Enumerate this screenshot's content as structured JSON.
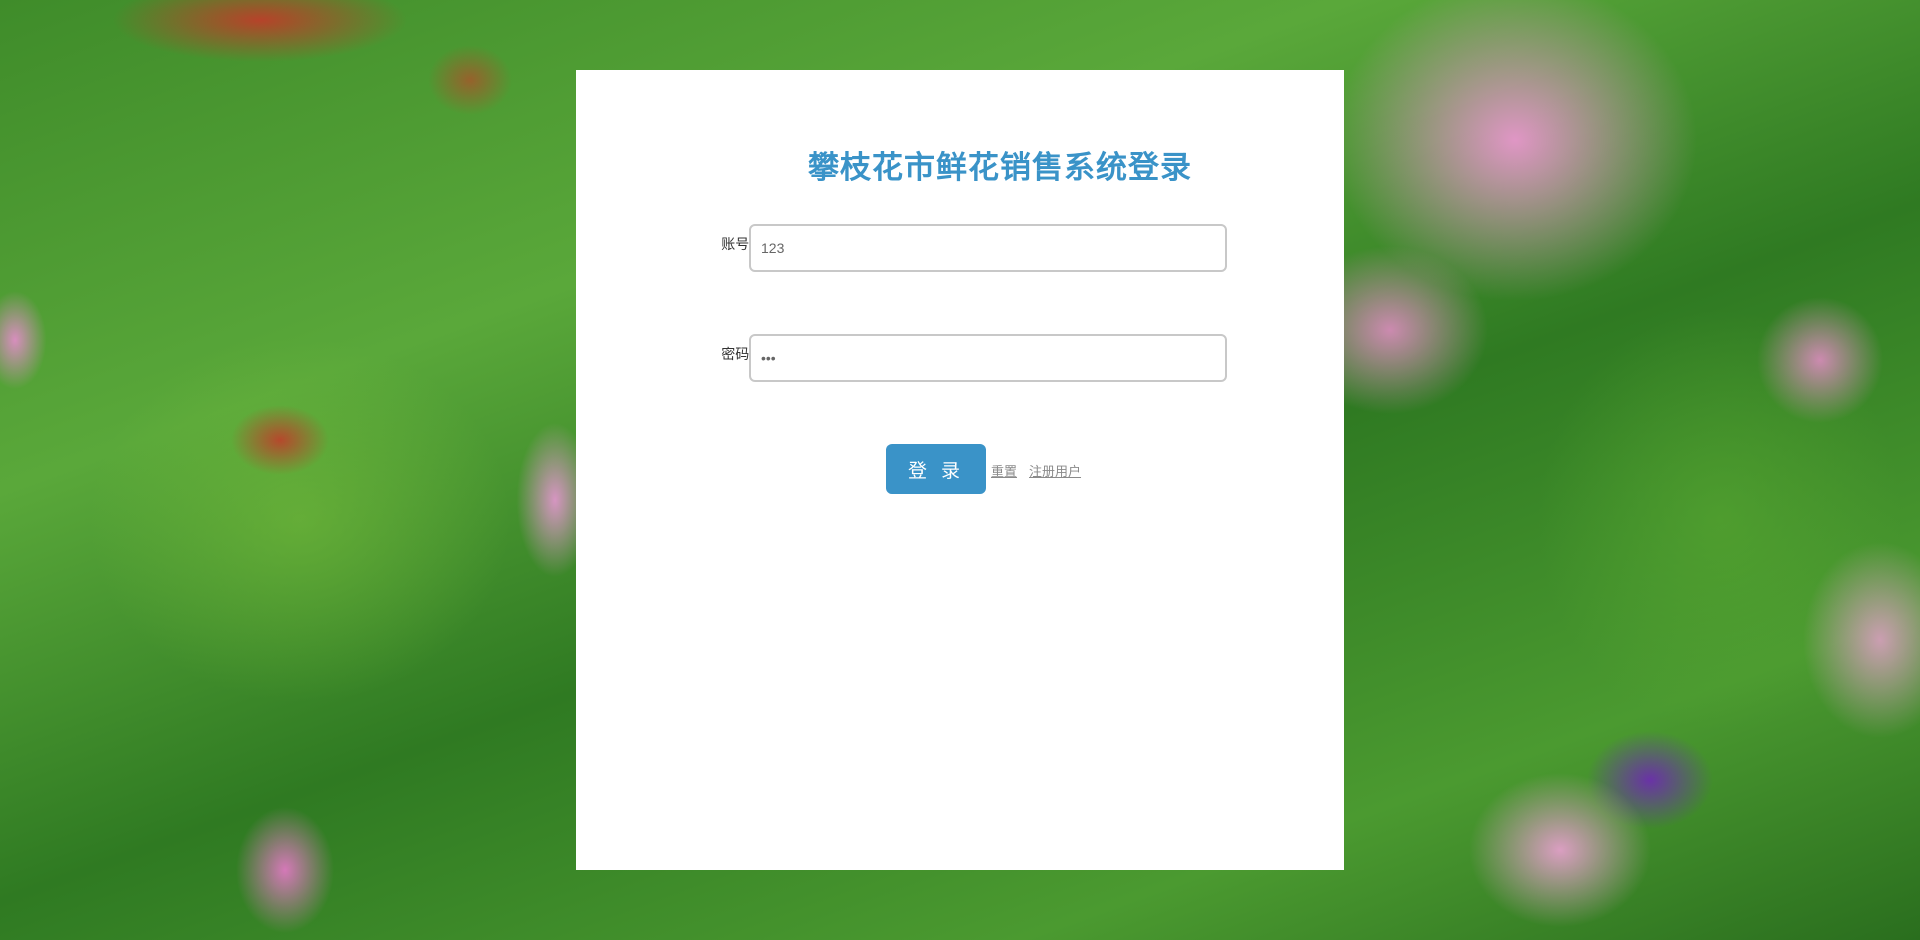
{
  "page": {
    "title": "攀枝花市鲜花销售系统登录"
  },
  "form": {
    "account_label": "账号:",
    "account_value": "123",
    "password_label": "密码:",
    "password_value": "123"
  },
  "actions": {
    "login_label": "登 录",
    "reset_label": "重置",
    "register_label": "注册用户"
  },
  "colors": {
    "accent": "#3a93c8",
    "card_background": "#ffffff"
  }
}
